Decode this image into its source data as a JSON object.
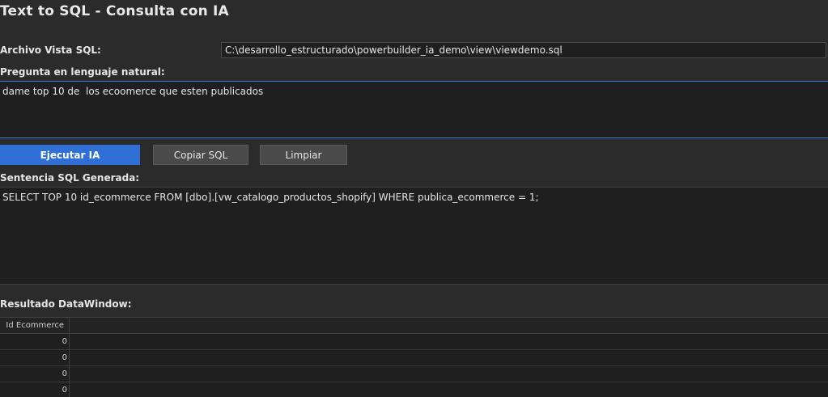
{
  "window": {
    "title": "Text to SQL - Consulta con IA"
  },
  "file": {
    "label": "Archivo Vista SQL:",
    "value": "C:\\desarrollo_estructurado\\powerbuilder_ia_demo\\view\\viewdemo.sql"
  },
  "question": {
    "label": "Pregunta en lenguaje natural:",
    "value": "dame top 10 de  los ecoomerce que esten publicados"
  },
  "buttons": {
    "run_label": "Ejecutar IA",
    "copy_label": "Copiar SQL",
    "clear_label": "Limpiar"
  },
  "sql": {
    "label": "Sentencia SQL Generada:",
    "value": "SELECT TOP 10 id_ecommerce FROM [dbo].[vw_catalogo_productos_shopify] WHERE publica_ecommerce = 1;"
  },
  "result": {
    "label": "Resultado DataWindow:",
    "column_header": "Id Ecommerce",
    "rows": [
      "0",
      "0",
      "0",
      "0"
    ]
  },
  "colors": {
    "background": "#2b2b2b",
    "field_background": "#1f1f1f",
    "accent": "#2f6fd6",
    "button_gray": "#4a4a4a"
  }
}
